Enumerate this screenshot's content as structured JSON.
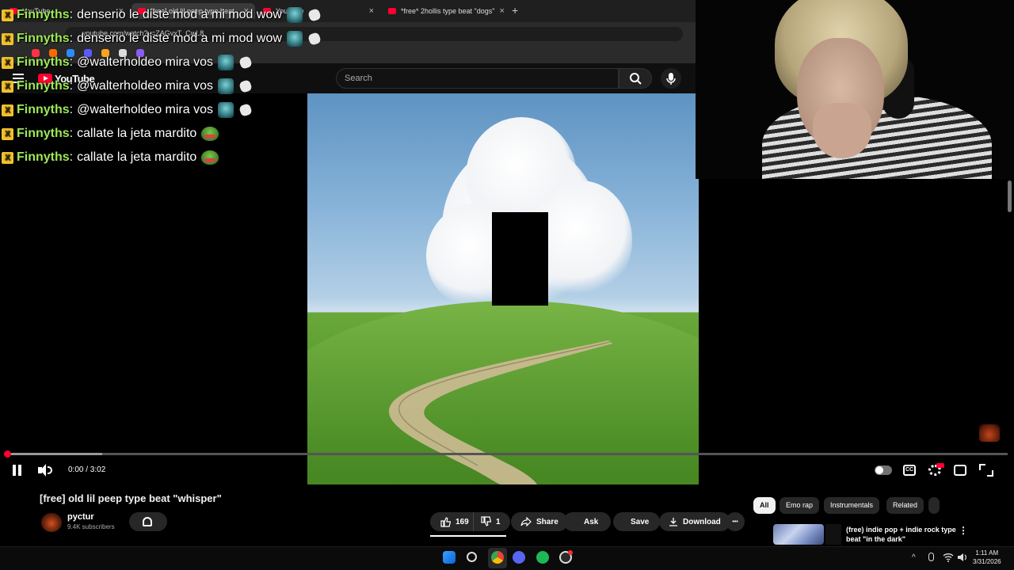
{
  "browser": {
    "tabs": [
      {
        "label": "YouTube",
        "close": "×"
      },
      {
        "label": "[free] old lil peep type beat",
        "close": "×"
      },
      {
        "label": "YouTube",
        "close": "×"
      },
      {
        "label": "*free* 2hollis type beat \"dogs\"",
        "close": "×"
      }
    ],
    "new_tab": "+",
    "url": "youtube.com/watch?v=ZAGvxT_CwL8"
  },
  "youtube": {
    "logo": "YouTube",
    "search_placeholder": "Search",
    "search_icon": "search-icon",
    "mic_icon": "mic-icon"
  },
  "player": {
    "time": "0:00 / 3:02",
    "progress": 0.0,
    "buffered": 0.096,
    "cc_label": "CC",
    "hd_badge": "HD",
    "accent": "#ff0033"
  },
  "video_info": {
    "title": "[free] old lil peep type beat \"whisper\"",
    "channel": "pyctur",
    "subscribers": "9.4K subscribers",
    "likes": "169",
    "dislikes": "1",
    "actions": {
      "share": "Share",
      "ask": "Ask",
      "save": "Save",
      "download": "Download",
      "more": "•••"
    }
  },
  "chips": [
    "All",
    "Emo rap",
    "Instrumentals",
    "Related"
  ],
  "recommended": {
    "title": "(free) indie pop + indie rock type beat \"in the dark\"",
    "menu": "⋮"
  },
  "chat": [
    {
      "user": "Finnyths",
      "text": "denserio le diste mod a mi mod wow",
      "emotes": "teal+hand"
    },
    {
      "user": "Finnyths",
      "text": "denserio le diste mod a mi mod wow",
      "emotes": "teal+hand"
    },
    {
      "user": "Finnyths",
      "text": "@walterholdeo mira vos",
      "emotes": "teal+hand"
    },
    {
      "user": "Finnyths",
      "text": "@walterholdeo mira vos",
      "emotes": "teal+hand"
    },
    {
      "user": "Finnyths",
      "text": "@walterholdeo mira vos",
      "emotes": "teal+hand"
    },
    {
      "user": "Finnyths",
      "text": "callate la jeta mardito",
      "emotes": "frog"
    },
    {
      "user": "Finnyths",
      "text": "callate la jeta mardito",
      "emotes": "frog"
    }
  ],
  "chat_separator": ":",
  "chat_badge": "X",
  "taskbar": {
    "icons": [
      "windows-icon",
      "search-icon",
      "chrome-icon",
      "discord-icon",
      "spotify-icon",
      "obs-icon"
    ],
    "tray": [
      "^",
      "mic",
      "wifi",
      "speaker"
    ],
    "time": "1:11 AM",
    "date": "3/31/2026"
  },
  "colors": {
    "username": "#9ee857",
    "youtube_red": "#ff0033",
    "background": "#0f0f0f"
  }
}
